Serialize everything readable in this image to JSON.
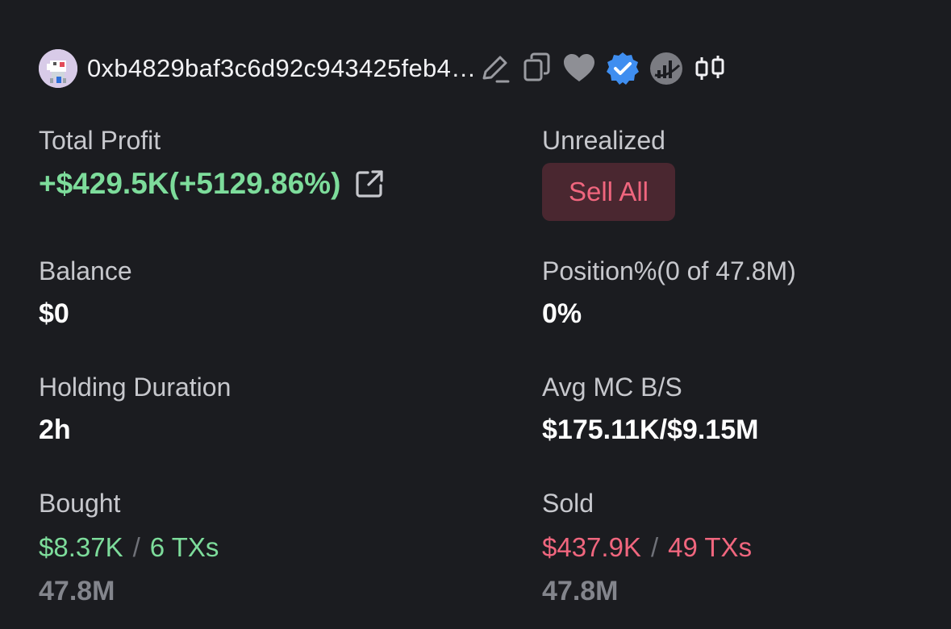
{
  "header": {
    "address": "0xb4829baf3c6d92c943425feb4…",
    "icons": [
      "edit-icon",
      "copy-icon",
      "heart-icon",
      "verified-badge-icon",
      "chart-app-icon",
      "candlestick-icon"
    ]
  },
  "total_profit": {
    "label": "Total Profit",
    "value": "+$429.5K(+5129.86%)"
  },
  "unrealized": {
    "label": "Unrealized",
    "button": "Sell All"
  },
  "balance": {
    "label": "Balance",
    "value": "$0"
  },
  "position": {
    "label": "Position%(0 of 47.8M)",
    "value": "0%"
  },
  "holding": {
    "label": "Holding Duration",
    "value": "2h"
  },
  "avg_mc": {
    "label": "Avg MC B/S",
    "value": "$175.11K/$9.15M"
  },
  "bought": {
    "label": "Bought",
    "amount": "$8.37K",
    "separator": "/",
    "txs": "6 TXs",
    "tokens": "47.8M"
  },
  "sold": {
    "label": "Sold",
    "amount": "$437.9K",
    "separator": "/",
    "txs": "49 TXs",
    "tokens": "47.8M"
  },
  "colors": {
    "background": "#1b1c20",
    "profit_green": "#7ddc9b",
    "loss_red": "#f0667e",
    "sell_button_bg": "#4a2730",
    "verified_blue": "#3f8ef0"
  }
}
